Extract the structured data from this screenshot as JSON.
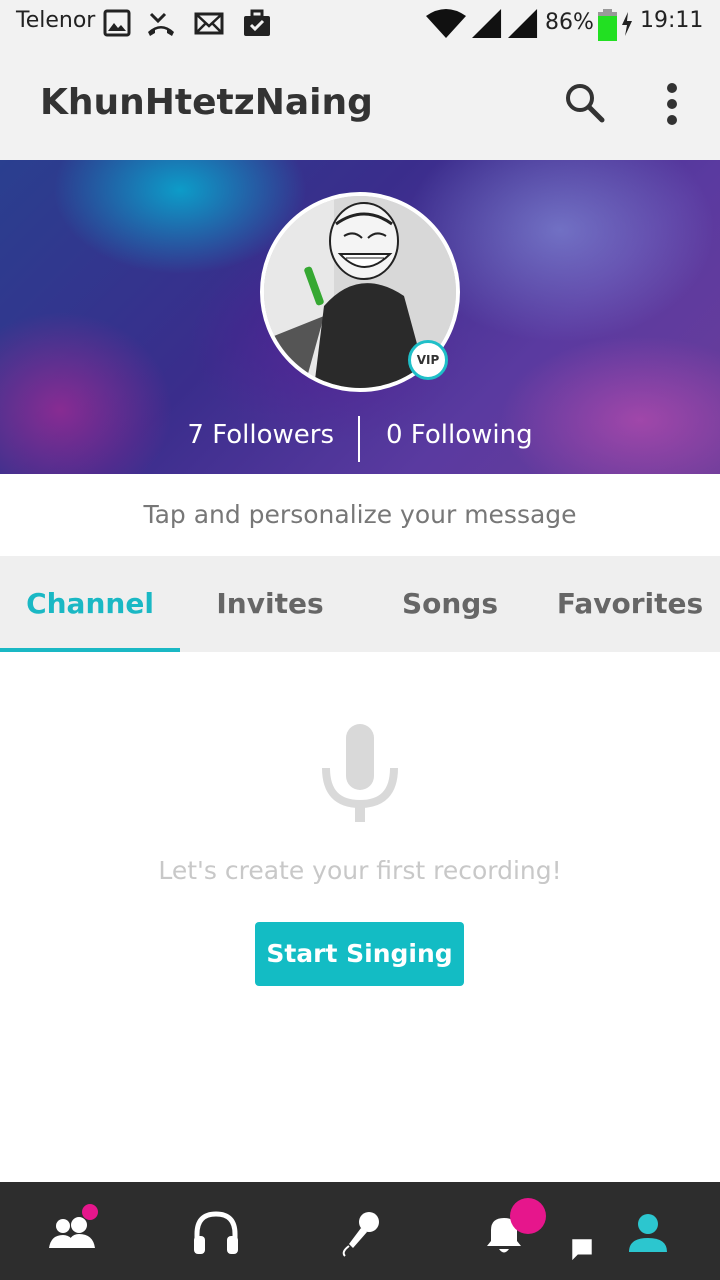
{
  "status_bar": {
    "carrier": "Telenor",
    "battery_percent": "86%",
    "time": "19:11",
    "icons": [
      "gallery-icon",
      "missed-call-icon",
      "mail-icon",
      "briefcase-icon",
      "wifi-icon",
      "signal-icon",
      "battery-charging-icon"
    ]
  },
  "app_bar": {
    "title": "KhunHtetzNaing",
    "actions": [
      "search-icon",
      "more-vert-icon"
    ]
  },
  "profile": {
    "badge": "VIP",
    "followers": "7 Followers",
    "following": "0 Following"
  },
  "message_prompt": "Tap and personalize your message",
  "tabs": [
    {
      "label": "Channel",
      "active": true
    },
    {
      "label": "Invites",
      "active": false
    },
    {
      "label": "Songs",
      "active": false
    },
    {
      "label": "Favorites",
      "active": false
    }
  ],
  "empty_state": {
    "icon": "microphone-icon",
    "text": "Let's create your first recording!",
    "button": "Start Singing"
  },
  "bottom_nav": [
    {
      "name": "people-icon",
      "has_dot": true
    },
    {
      "name": "headphones-icon",
      "has_dot": false
    },
    {
      "name": "sing-mic-icon",
      "has_dot": false
    },
    {
      "name": "notifications-icon",
      "has_chat_badge": true
    },
    {
      "name": "profile-icon",
      "active": true
    }
  ],
  "colors": {
    "accent": "#1ab8c4",
    "badge": "#e6168c",
    "nav_bg": "#2d2d2d"
  }
}
